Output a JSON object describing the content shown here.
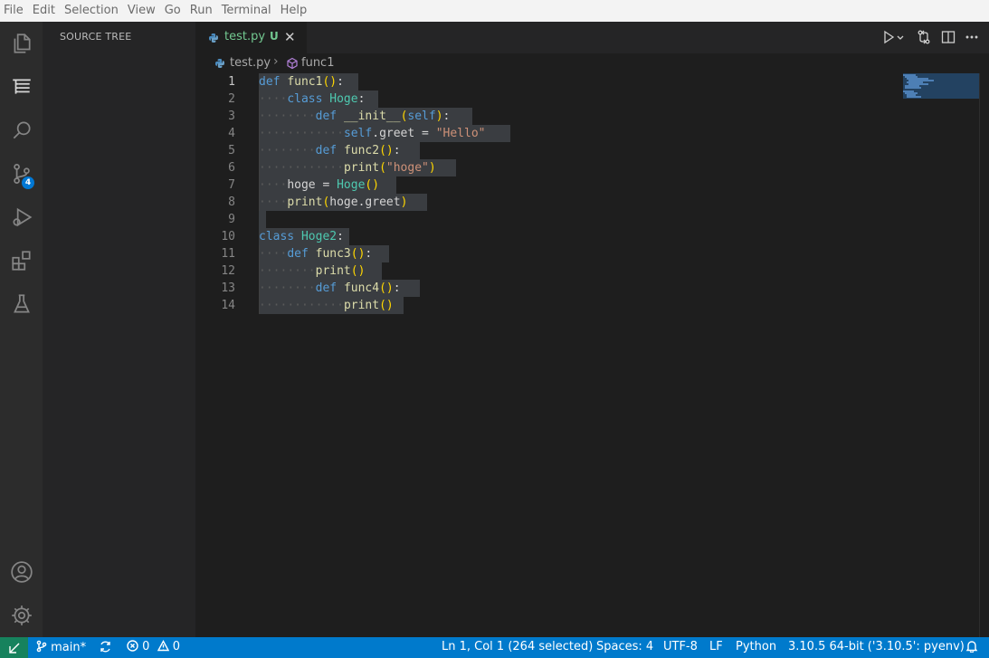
{
  "menu": [
    "File",
    "Edit",
    "Selection",
    "View",
    "Go",
    "Run",
    "Terminal",
    "Help"
  ],
  "activity_bar": {
    "items": [
      "explorer-icon",
      "source-tree-icon",
      "search-icon",
      "source-control-icon",
      "run-debug-icon",
      "extensions-icon",
      "testing-icon"
    ],
    "source_control_badge": "4",
    "bottom": [
      "accounts-icon",
      "manage-gear-icon"
    ]
  },
  "sidebar": {
    "title": "SOURCE TREE"
  },
  "tab": {
    "label": "test.py",
    "status": "U"
  },
  "breadcrumb": {
    "file": "test.py",
    "symbol": "func1"
  },
  "editor": {
    "current_line": 1,
    "lines": [
      {
        "n": "1",
        "text": "def func1():"
      },
      {
        "n": "2",
        "text": "    class Hoge:"
      },
      {
        "n": "3",
        "text": "        def __init__(self):"
      },
      {
        "n": "4",
        "text": "            self.greet = \"Hello\""
      },
      {
        "n": "5",
        "text": "        def func2():"
      },
      {
        "n": "6",
        "text": "            print(\"hoge\")"
      },
      {
        "n": "7",
        "text": "    hoge = Hoge()"
      },
      {
        "n": "8",
        "text": "    print(hoge.greet)"
      },
      {
        "n": "9",
        "text": ""
      },
      {
        "n": "10",
        "text": "class Hoge2:"
      },
      {
        "n": "11",
        "text": "    def func3():"
      },
      {
        "n": "12",
        "text": "        print()"
      },
      {
        "n": "13",
        "text": "        def func4():"
      },
      {
        "n": "14",
        "text": "            print()"
      }
    ]
  },
  "status_bar": {
    "branch": "main*",
    "errors": "0",
    "warnings": "0",
    "position": "Ln 1, Col 1 (264 selected)",
    "spaces": "Spaces: 4",
    "encoding": "UTF-8",
    "eol": "LF",
    "language": "Python",
    "interpreter": "3.10.5 64-bit ('3.10.5': pyenv)"
  },
  "colors": {
    "accent": "#007acc",
    "remote": "#16825d",
    "untracked": "#73c991",
    "keyword": "#569cd6",
    "function": "#dcdcaa",
    "class": "#4ec9b0",
    "string": "#ce9178",
    "bracket": "#ffd700"
  }
}
